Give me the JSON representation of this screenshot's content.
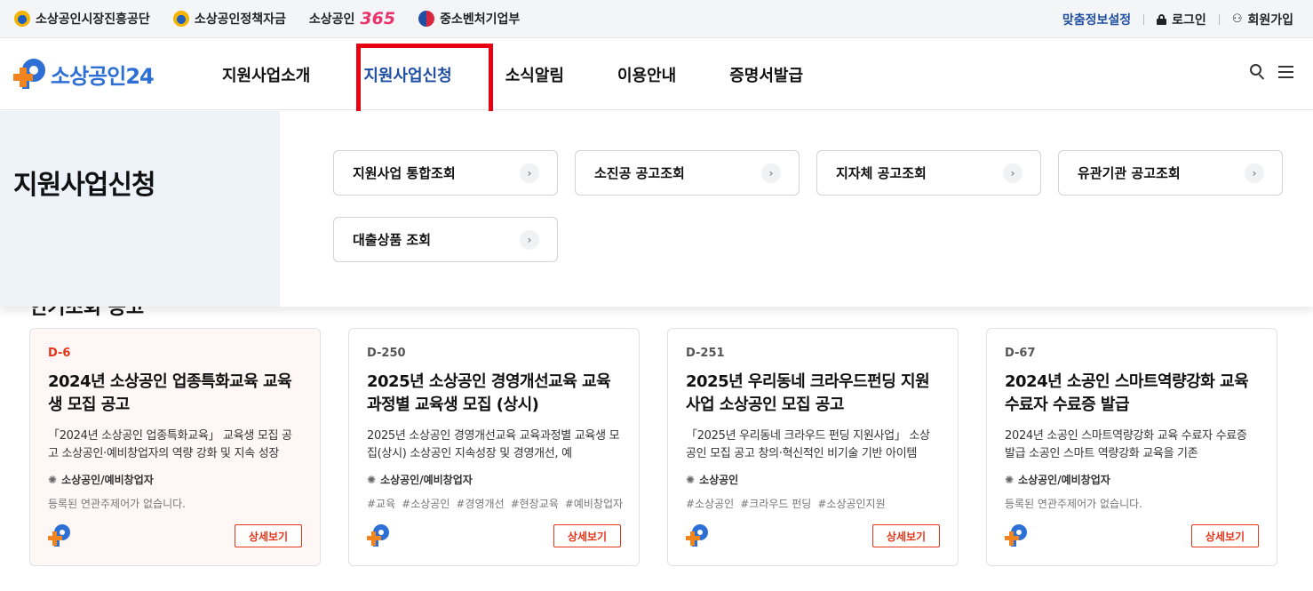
{
  "topbar": {
    "sites": [
      {
        "label": "소상공인시장진흥공단",
        "icon": "sbiz-emblem-icon"
      },
      {
        "label": "소상공인정책자금",
        "icon": "sbiz-emblem-icon"
      },
      {
        "label_prefix": "소상공인",
        "label_num": "365"
      },
      {
        "label": "중소벤처기업부",
        "icon": "government-emblem-icon"
      }
    ],
    "custom_info": "맞춤정보설정",
    "login": "로그인",
    "signup": "회원가입"
  },
  "header": {
    "logo_text": "소상공인24",
    "nav": [
      "지원사업소개",
      "지원사업신청",
      "소식알림",
      "이용안내",
      "증명서발급"
    ],
    "active_index": 1
  },
  "mega_menu": {
    "title": "지원사업신청",
    "links": [
      "지원사업 통합조회",
      "소진공 공고조회",
      "지자체 공고조회",
      "유관기관 공고조회",
      "대출상품 조회"
    ]
  },
  "section": {
    "title": "인기조회 공고"
  },
  "cards": [
    {
      "dday": "D-6",
      "title": "2024년 소상공인 업종특화교육 교육생 모집 공고",
      "desc": "「2024년 소상공인 업종특화교육」 교육생 모집 공고 소상공인·예비창업자의 역량 강화 및 지속 성장",
      "target": "소상공인/예비창업자",
      "tags": [],
      "no_tags": "등록된 연관주제어가 없습니다.",
      "button": "상세보기"
    },
    {
      "dday": "D-250",
      "title": "2025년 소상공인 경영개선교육 교육과정별 교육생 모집 (상시)",
      "desc": "2025년 소상공인 경영개선교육 교육과정별 교육생 모집(상시) 소상공인 지속성장 및 경영개선, 예",
      "target": "소상공인/예비창업자",
      "tags": [
        "#교육",
        "#소상공인",
        "#경영개선",
        "#현장교육",
        "#예비창업자"
      ],
      "no_tags": "",
      "button": "상세보기"
    },
    {
      "dday": "D-251",
      "title": "2025년 우리동네 크라우드펀딩 지원사업 소상공인 모집 공고",
      "desc": "「2025년 우리동네 크라우드 펀딩 지원사업」 소상공인 모집 공고 창의·혁신적인 비기술 기반 아이템",
      "target": "소상공인",
      "tags": [
        "#소상공인",
        "#크라우드 펀딩",
        "#소상공인지원"
      ],
      "no_tags": "",
      "button": "상세보기"
    },
    {
      "dday": "D-67",
      "title": "2024년 소공인 스마트역량강화 교육 수료자 수료증 발급",
      "desc": "2024년 소공인 스마트역량강화 교육 수료자 수료증 발급 소공인 스마트 역량강화 교육을 기존",
      "target": "소상공인/예비창업자",
      "tags": [],
      "no_tags": "등록된 연관주제어가 없습니다.",
      "button": "상세보기"
    }
  ],
  "colors": {
    "brand_blue": "#2e6fd6",
    "brand_orange": "#f0851f",
    "active_nav": "#1f4fa3",
    "highlight": "#e60012",
    "dday_hot": "#e2361a"
  }
}
